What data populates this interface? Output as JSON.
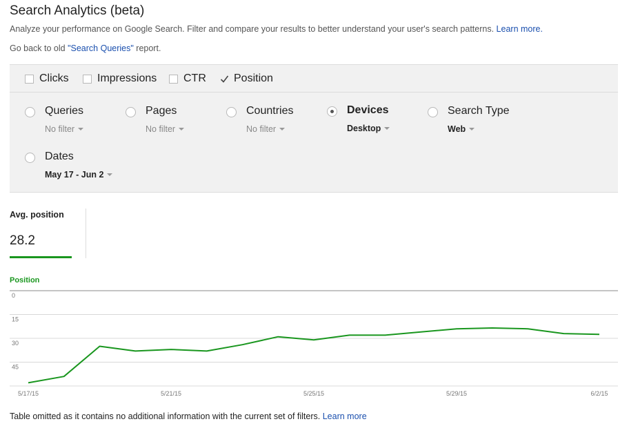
{
  "header": {
    "title": "Search Analytics (beta)",
    "description": "Analyze your performance on Google Search. Filter and compare your results to better understand your user's search patterns.",
    "learn_more": "Learn more.",
    "goback_prefix": "Go back to old ",
    "goback_link": "\"Search Queries\"",
    "goback_suffix": " report."
  },
  "metrics": [
    {
      "label": "Clicks",
      "checked": false
    },
    {
      "label": "Impressions",
      "checked": false
    },
    {
      "label": "CTR",
      "checked": false
    },
    {
      "label": "Position",
      "checked": true
    }
  ],
  "groups": [
    {
      "label": "Queries",
      "filter": "No filter",
      "selected": false,
      "active": false
    },
    {
      "label": "Pages",
      "filter": "No filter",
      "selected": false,
      "active": false
    },
    {
      "label": "Countries",
      "filter": "No filter",
      "selected": false,
      "active": false
    },
    {
      "label": "Devices",
      "filter": "Desktop",
      "selected": true,
      "active": true
    },
    {
      "label": "Search Type",
      "filter": "Web",
      "selected": false,
      "active": true
    },
    {
      "label": "Dates",
      "filter": "May 17 - Jun 2",
      "selected": false,
      "active": true
    }
  ],
  "stat": {
    "label": "Avg. position",
    "value": "28.2"
  },
  "chart_data": {
    "type": "line",
    "title": "",
    "series_label": "Position",
    "x": [
      "5/17/15",
      "5/18/15",
      "5/19/15",
      "5/20/15",
      "5/21/15",
      "5/22/15",
      "5/23/15",
      "5/24/15",
      "5/25/15",
      "5/26/15",
      "5/27/15",
      "5/28/15",
      "5/29/15",
      "5/30/15",
      "5/31/15",
      "6/1/15",
      "6/2/15"
    ],
    "x_tick_labels": [
      "5/17/15",
      "5/21/15",
      "5/25/15",
      "5/29/15",
      "6/2/15"
    ],
    "x_tick_indices": [
      0,
      4,
      8,
      12,
      16
    ],
    "series": [
      {
        "values": [
          58,
          54,
          35,
          38,
          37,
          38,
          34,
          29,
          31,
          28,
          28,
          26,
          24,
          23.5,
          24,
          27,
          27.5
        ]
      }
    ],
    "y_ticks": [
      0,
      15,
      30,
      45
    ],
    "ylim": [
      0,
      60
    ],
    "y_inverted": true,
    "line_color": "#19961e",
    "grid": true
  },
  "footer": {
    "text": "Table omitted as it contains no additional information with the current set of filters.",
    "link": "Learn more"
  }
}
